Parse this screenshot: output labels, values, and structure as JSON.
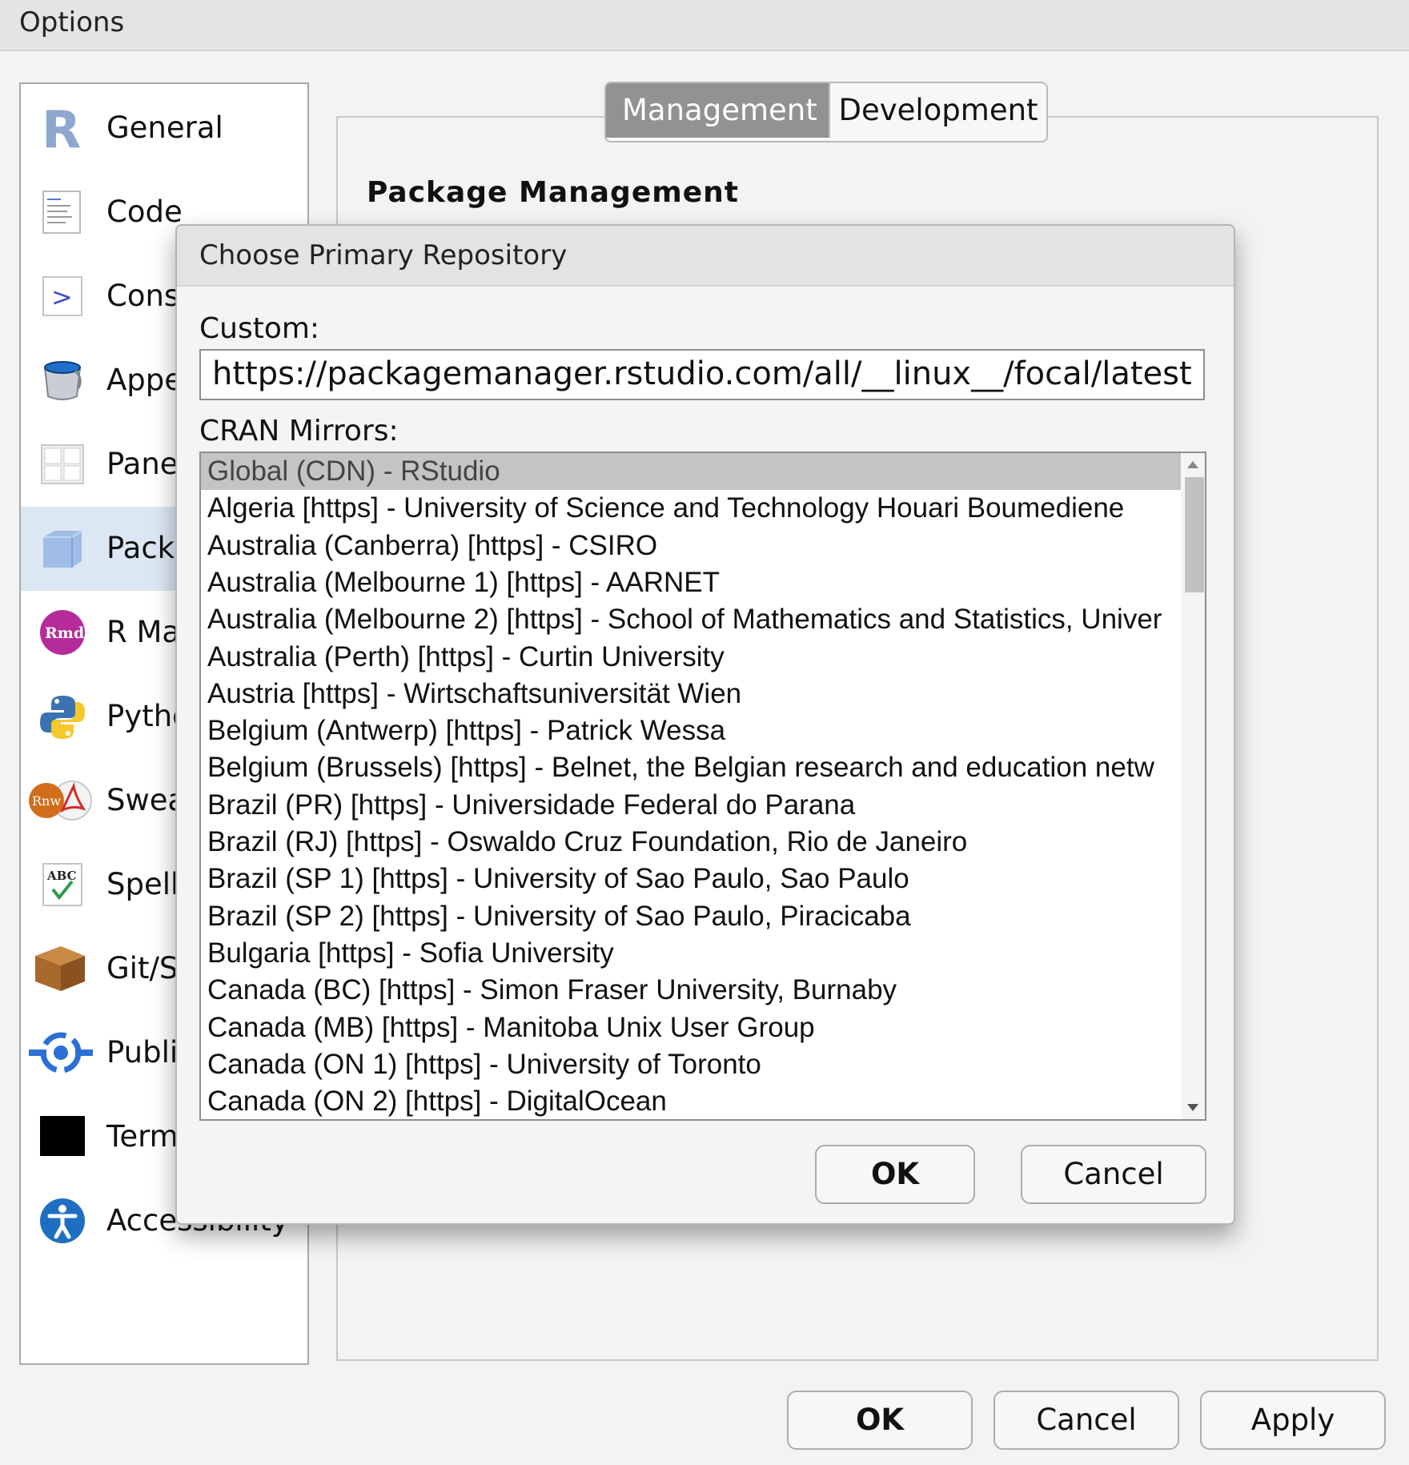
{
  "window": {
    "title": "Options"
  },
  "sidebar": {
    "items": [
      {
        "label": "General",
        "icon": "r-logo-icon"
      },
      {
        "label": "Code",
        "icon": "code-icon"
      },
      {
        "label": "Cons",
        "icon": "console-icon"
      },
      {
        "label": "Appe",
        "icon": "paint-bucket-icon"
      },
      {
        "label": "Pane",
        "icon": "pane-layout-icon"
      },
      {
        "label": "Packa",
        "icon": "package-icon",
        "selected": true
      },
      {
        "label": "R Ma",
        "icon": "rmarkdown-icon"
      },
      {
        "label": "Pytho",
        "icon": "python-icon"
      },
      {
        "label": "Swea",
        "icon": "sweave-icon"
      },
      {
        "label": "Spell",
        "icon": "spelling-icon"
      },
      {
        "label": "Git/S",
        "icon": "git-box-icon"
      },
      {
        "label": "Publi",
        "icon": "publish-icon"
      },
      {
        "label": "Term",
        "icon": "terminal-icon"
      },
      {
        "label": "Accessibility",
        "icon": "accessibility-icon"
      }
    ]
  },
  "tabs": [
    {
      "label": "Management",
      "active": true
    },
    {
      "label": "Development",
      "active": false
    }
  ],
  "section": {
    "title": "Package Management"
  },
  "dialog": {
    "title": "Choose Primary Repository",
    "custom_label": "Custom:",
    "custom_value": "https://packagemanager.rstudio.com/all/__linux__/focal/latest",
    "mirrors_label": "CRAN Mirrors:",
    "mirrors": [
      "Global (CDN) - RStudio",
      "Algeria [https] - University of Science and Technology Houari Boumediene",
      "Australia (Canberra) [https] - CSIRO",
      "Australia (Melbourne 1) [https] - AARNET",
      "Australia (Melbourne 2) [https] - School of Mathematics and Statistics, Univer",
      "Australia (Perth) [https] - Curtin University",
      "Austria [https] - Wirtschaftsuniversität Wien",
      "Belgium (Antwerp) [https] - Patrick Wessa",
      "Belgium (Brussels) [https] - Belnet, the Belgian research and education netw",
      "Brazil (PR) [https] - Universidade Federal do Parana",
      "Brazil (RJ) [https] - Oswaldo Cruz Foundation, Rio de Janeiro",
      "Brazil (SP 1) [https] - University of Sao Paulo, Sao Paulo",
      "Brazil (SP 2) [https] - University of Sao Paulo, Piracicaba",
      "Bulgaria [https] - Sofia University",
      "Canada (BC) [https] - Simon Fraser University, Burnaby",
      "Canada (MB) [https] - Manitoba Unix User Group",
      "Canada (ON 1) [https] - University of Toronto",
      "Canada (ON 2) [https] - DigitalOcean"
    ],
    "selected_index": 0,
    "ok_label": "OK",
    "cancel_label": "Cancel"
  },
  "footer": {
    "ok_label": "OK",
    "cancel_label": "Cancel",
    "apply_label": "Apply"
  }
}
